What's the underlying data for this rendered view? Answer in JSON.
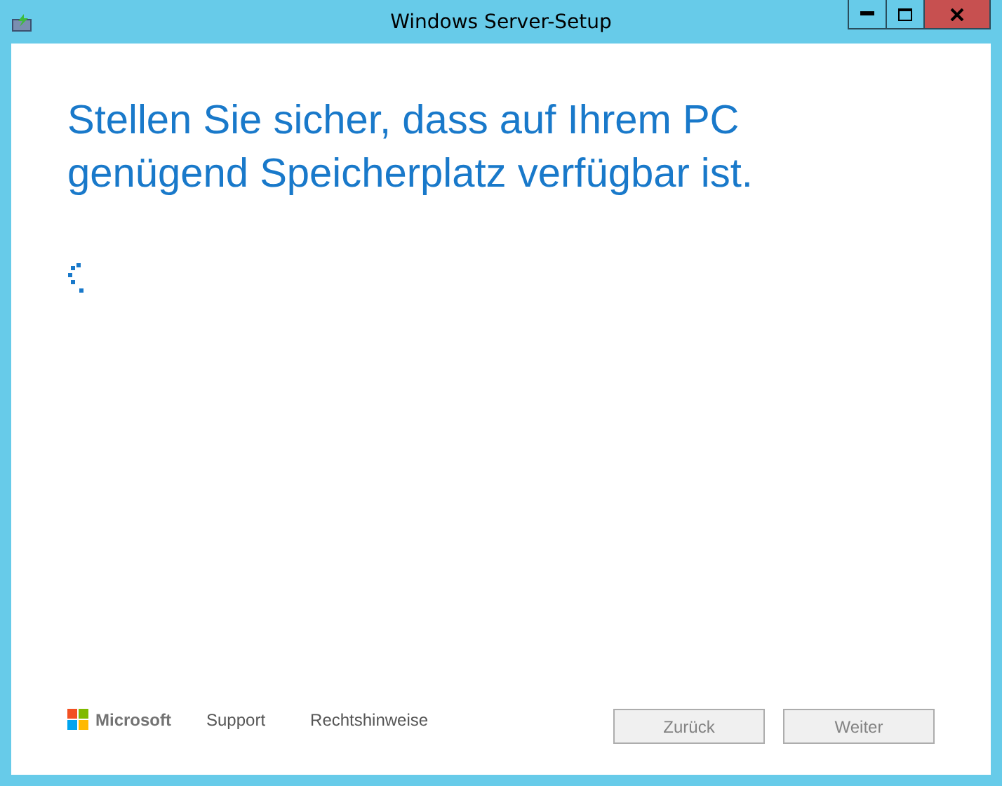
{
  "window": {
    "title": "Windows Server-Setup"
  },
  "heading": "Stellen Sie sicher, dass auf Ihrem PC genügend Speicherplatz verfügbar ist.",
  "footer": {
    "brand": "Microsoft",
    "links": [
      "Support",
      "Rechtshinweise"
    ]
  },
  "buttons": [
    {
      "label": "Zurück",
      "disabled": true
    },
    {
      "label": "Weiter",
      "disabled": true
    }
  ]
}
